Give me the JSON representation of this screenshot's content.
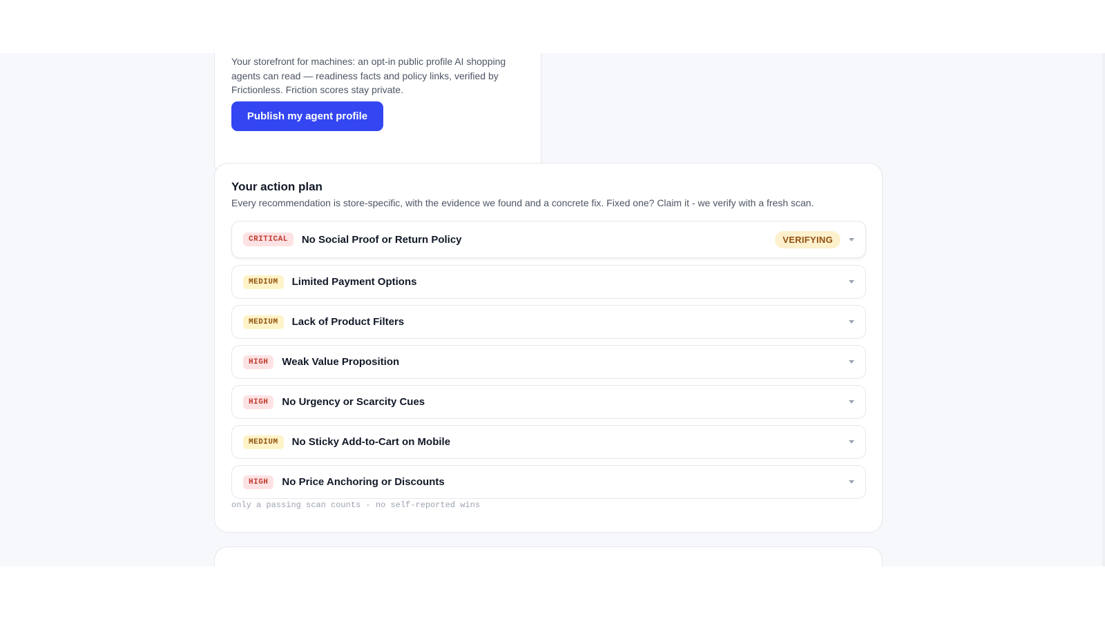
{
  "agent_profile": {
    "description": "Your storefront for machines: an opt-in public profile AI shopping agents can read — readiness facts and policy links, verified by Frictionless. Friction scores stay private.",
    "publish_button_label": "Publish my agent profile"
  },
  "action_plan": {
    "title": "Your action plan",
    "subtitle": "Every recommendation is store-specific, with the evidence we found and a concrete fix. Fixed one? Claim it - we verify with a fresh scan.",
    "items": [
      {
        "severity": "CRITICAL",
        "title": "No Social Proof or Return Policy",
        "status": "VERIFYING",
        "icon": "chevron-down-icon"
      },
      {
        "severity": "MEDIUM",
        "title": "Limited Payment Options",
        "icon": "chevron-down-icon"
      },
      {
        "severity": "MEDIUM",
        "title": "Lack of Product Filters",
        "icon": "chevron-down-icon"
      },
      {
        "severity": "HIGH",
        "title": "Weak Value Proposition",
        "icon": "chevron-down-icon"
      },
      {
        "severity": "HIGH",
        "title": "No Urgency or Scarcity Cues",
        "icon": "chevron-down-icon"
      },
      {
        "severity": "MEDIUM",
        "title": "No Sticky Add-to-Cart on Mobile",
        "icon": "chevron-down-icon"
      },
      {
        "severity": "HIGH",
        "title": "No Price Anchoring or Discounts",
        "icon": "chevron-down-icon"
      }
    ],
    "footnote": "only a passing scan counts - no self-reported wins"
  },
  "colors": {
    "primary": "#3346f2",
    "severity_critical": "#c0392b",
    "severity_high": "#c0392b",
    "severity_medium": "#92500e",
    "status_verifying_bg": "#fdf0cc"
  }
}
